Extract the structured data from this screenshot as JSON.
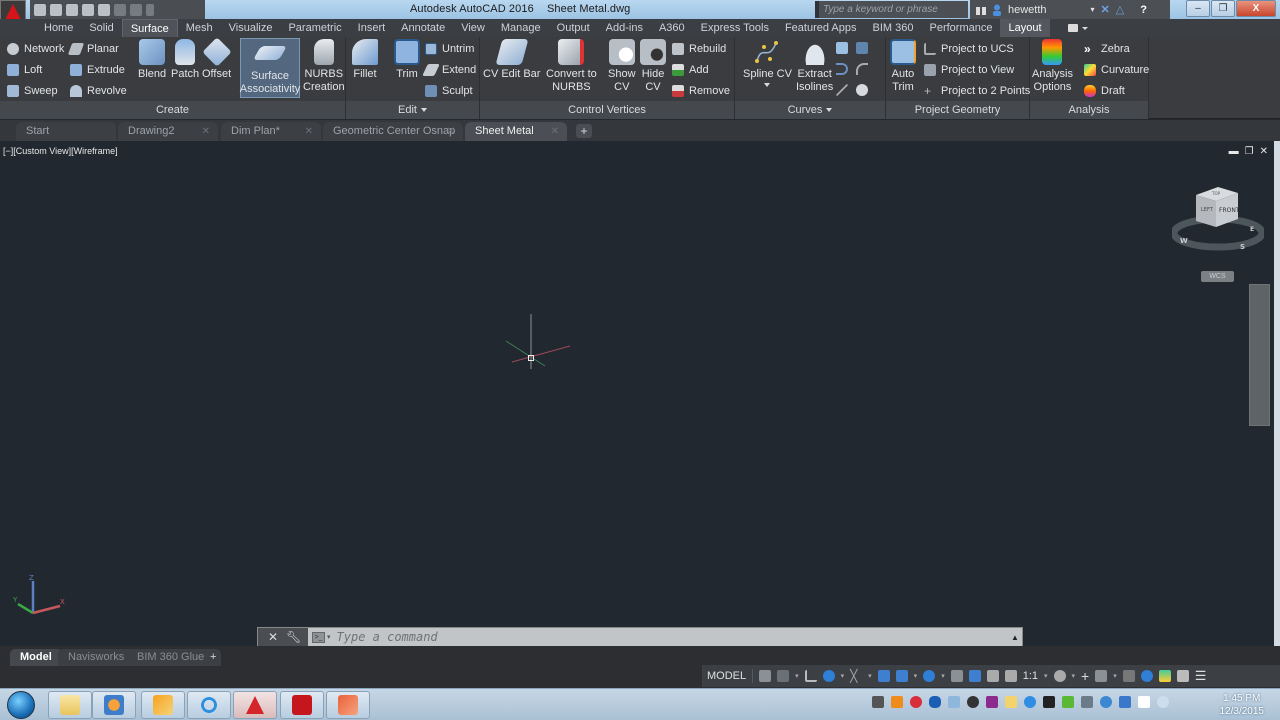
{
  "window": {
    "app_title": "Autodesk AutoCAD 2016",
    "file_title": "Sheet Metal.dwg",
    "search_placeholder": "Type a keyword or phrase",
    "username": "hewetth",
    "controls": {
      "minimize": "–",
      "maximize": "❐",
      "close": "X"
    }
  },
  "quick_access": [
    "new-icon",
    "open-icon",
    "save-icon",
    "save-as-icon",
    "plot-icon",
    "undo-icon",
    "redo-icon",
    "customize-icon"
  ],
  "ribbon_tabs": [
    {
      "label": "Home"
    },
    {
      "label": "Solid"
    },
    {
      "label": "Surface",
      "active": true
    },
    {
      "label": "Mesh"
    },
    {
      "label": "Visualize"
    },
    {
      "label": "Parametric"
    },
    {
      "label": "Insert"
    },
    {
      "label": "Annotate"
    },
    {
      "label": "View"
    },
    {
      "label": "Manage"
    },
    {
      "label": "Output"
    },
    {
      "label": "Add-ins"
    },
    {
      "label": "A360"
    },
    {
      "label": "Express Tools"
    },
    {
      "label": "Featured Apps"
    },
    {
      "label": "BIM 360"
    },
    {
      "label": "Performance"
    },
    {
      "label": "Layout"
    }
  ],
  "ribbon": {
    "create": {
      "title": "Create",
      "small": [
        "Network",
        "Loft",
        "Sweep",
        "Planar",
        "Extrude",
        "Revolve"
      ],
      "big": [
        "Blend",
        "Patch",
        "Offset"
      ],
      "surface_assoc": [
        "Surface",
        "Associativity"
      ],
      "nurbs": [
        "NURBS",
        "Creation"
      ]
    },
    "edit": {
      "title": "Edit",
      "fillet": "Fillet",
      "trim": "Trim",
      "small": [
        "Untrim",
        "Extend",
        "Sculpt"
      ]
    },
    "control_vertices": {
      "title": "Control Vertices",
      "cv_edit_bar": "CV Edit Bar",
      "convert": [
        "Convert to",
        "NURBS"
      ],
      "show_cv": [
        "Show",
        "CV"
      ],
      "hide_cv": [
        "Hide",
        "CV"
      ],
      "small": [
        "Rebuild",
        "Add",
        "Remove"
      ]
    },
    "curves": {
      "title": "Curves",
      "spline_cv": "Spline CV",
      "extract": [
        "Extract",
        "Isolines"
      ]
    },
    "project_geometry": {
      "title": "Project Geometry",
      "auto_trim": [
        "Auto",
        "Trim"
      ],
      "small": [
        "Project to UCS",
        "Project to View",
        "Project to 2 Points"
      ]
    },
    "analysis": {
      "title": "Analysis",
      "options": [
        "Analysis",
        "Options"
      ],
      "small": [
        "Zebra",
        "Curvature",
        "Draft"
      ]
    }
  },
  "doc_tabs": [
    {
      "label": "Start"
    },
    {
      "label": "Drawing2"
    },
    {
      "label": "Dim Plan*"
    },
    {
      "label": "Geometric Center Osnap"
    },
    {
      "label": "Sheet Metal",
      "active": true
    }
  ],
  "viewport": {
    "label": "[−][Custom View][Wireframe]",
    "viewcube": {
      "top": "TOP",
      "left": "LEFT",
      "front": "FRONT",
      "compass": [
        "W",
        "S",
        "E"
      ],
      "wcs": "WCS"
    },
    "ucs_axes": [
      "X",
      "Y",
      "Z"
    ]
  },
  "command_line": {
    "placeholder": "Type a command"
  },
  "layout_tabs": [
    {
      "label": "Model",
      "active": true
    },
    {
      "label": "Navisworks"
    },
    {
      "label": "BIM 360 Glue"
    }
  ],
  "status_bar": {
    "model_label": "MODEL",
    "scale": "1:1"
  },
  "taskbar": {
    "apps": [
      "windows-explorer",
      "media-player",
      "outlook",
      "internet-explorer",
      "autocad",
      "acrobat",
      "powerpoint"
    ],
    "time": "1:45 PM",
    "date": "12/3/2015"
  },
  "colors": {
    "viewport_bg": "#212830",
    "ribbon_bg": "#3a3c40",
    "active_button": "#53677f",
    "autocad_red": "#d8141b"
  }
}
